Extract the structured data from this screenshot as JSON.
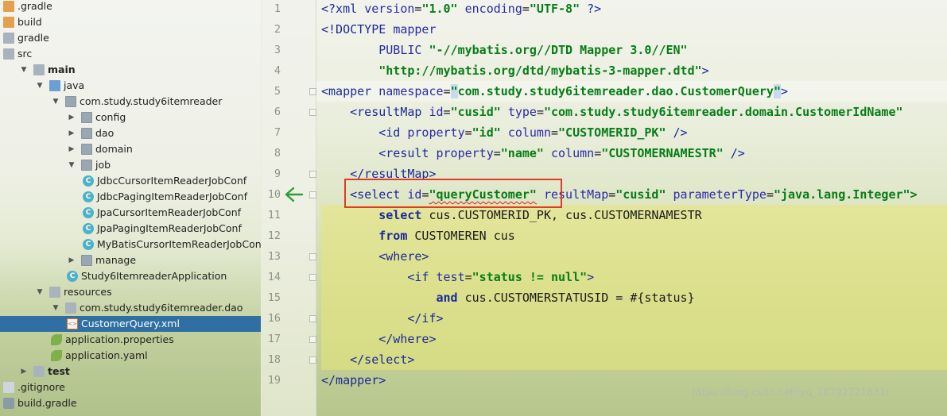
{
  "project_tree": {
    "items": [
      {
        "label": ".gradle",
        "indent": 0,
        "icon": "folder-orange-icon",
        "arrow": "",
        "bold": false
      },
      {
        "label": "build",
        "indent": 0,
        "icon": "folder-orange-icon",
        "arrow": "",
        "bold": false
      },
      {
        "label": "gradle",
        "indent": 0,
        "icon": "folder-icon",
        "arrow": "",
        "bold": false
      },
      {
        "label": "src",
        "indent": 0,
        "icon": "folder-icon",
        "arrow": "",
        "bold": false
      },
      {
        "label": "main",
        "indent": 1,
        "icon": "folder-icon",
        "arrow": "expanded",
        "bold": true
      },
      {
        "label": "java",
        "indent": 2,
        "icon": "folder-blue-icon",
        "arrow": "expanded",
        "bold": false
      },
      {
        "label": "com.study.study6itemreader",
        "indent": 3,
        "icon": "package-icon",
        "arrow": "expanded",
        "bold": false
      },
      {
        "label": "config",
        "indent": 4,
        "icon": "package-icon",
        "arrow": "collapsed",
        "bold": false
      },
      {
        "label": "dao",
        "indent": 4,
        "icon": "package-icon",
        "arrow": "collapsed",
        "bold": false
      },
      {
        "label": "domain",
        "indent": 4,
        "icon": "package-icon",
        "arrow": "collapsed",
        "bold": false
      },
      {
        "label": "job",
        "indent": 4,
        "icon": "package-icon",
        "arrow": "expanded",
        "bold": false
      },
      {
        "label": "JdbcCursorItemReaderJobConf",
        "indent": 5,
        "icon": "class-icon",
        "arrow": "",
        "bold": false
      },
      {
        "label": "JdbcPagingItemReaderJobConf",
        "indent": 5,
        "icon": "class-icon",
        "arrow": "",
        "bold": false
      },
      {
        "label": "JpaCursorItemReaderJobConf",
        "indent": 5,
        "icon": "class-icon",
        "arrow": "",
        "bold": false
      },
      {
        "label": "JpaPagingItemReaderJobConf",
        "indent": 5,
        "icon": "class-icon",
        "arrow": "",
        "bold": false
      },
      {
        "label": "MyBatisCursorItemReaderJobConf",
        "indent": 5,
        "icon": "class-icon",
        "arrow": "",
        "bold": false
      },
      {
        "label": "manage",
        "indent": 4,
        "icon": "package-icon",
        "arrow": "collapsed",
        "bold": false
      },
      {
        "label": "Study6ItemreaderApplication",
        "indent": 4,
        "icon": "spring-class-icon",
        "arrow": "",
        "bold": false
      },
      {
        "label": "resources",
        "indent": 2,
        "icon": "resources-folder-icon",
        "arrow": "expanded",
        "bold": false
      },
      {
        "label": "com.study.study6itemreader.dao",
        "indent": 3,
        "icon": "folder-icon",
        "arrow": "expanded",
        "bold": false
      },
      {
        "label": "CustomerQuery.xml",
        "indent": 4,
        "icon": "xml-file-icon",
        "arrow": "",
        "bold": false,
        "selected": true
      },
      {
        "label": "application.properties",
        "indent": 3,
        "icon": "spring-leaf-icon",
        "arrow": "",
        "bold": false
      },
      {
        "label": "application.yaml",
        "indent": 3,
        "icon": "spring-leaf-icon",
        "arrow": "",
        "bold": false
      },
      {
        "label": "test",
        "indent": 1,
        "icon": "folder-icon",
        "arrow": "collapsed",
        "bold": true
      },
      {
        "label": ".gitignore",
        "indent": 0,
        "icon": "file-icon",
        "arrow": "",
        "bold": false
      },
      {
        "label": "build.gradle",
        "indent": 0,
        "icon": "gradle-icon",
        "arrow": "",
        "bold": false
      }
    ]
  },
  "editor": {
    "line_numbers": [
      "1",
      "2",
      "3",
      "4",
      "5",
      "6",
      "7",
      "8",
      "9",
      "10",
      "11",
      "12",
      "13",
      "14",
      "15",
      "16",
      "17",
      "18",
      "19"
    ],
    "lines": [
      [
        [
          "t",
          "<?xml "
        ],
        [
          "a",
          "version"
        ],
        [
          "p",
          "="
        ],
        [
          "v",
          "\"1.0\""
        ],
        [
          "p",
          " "
        ],
        [
          "a",
          "encoding"
        ],
        [
          "p",
          "="
        ],
        [
          "v",
          "\"UTF-8\""
        ],
        [
          "p",
          " "
        ],
        [
          "t",
          "?>"
        ]
      ],
      [
        [
          "t",
          "<!DOCTYPE "
        ],
        [
          "a",
          "mapper"
        ]
      ],
      [
        [
          "p",
          "        "
        ],
        [
          "a",
          "PUBLIC "
        ],
        [
          "v",
          "\"-//mybatis.org//DTD Mapper 3.0//EN\""
        ]
      ],
      [
        [
          "p",
          "        "
        ],
        [
          "v",
          "\"http://mybatis.org/dtd/mybatis-3-mapper.dtd\""
        ],
        [
          "t",
          ">"
        ]
      ],
      [
        [
          "t",
          "<mapper "
        ],
        [
          "a",
          "namespace"
        ],
        [
          "p",
          "="
        ],
        [
          "vh",
          "\""
        ],
        [
          "v",
          "com.study.study6itemreader.dao.CustomerQuery"
        ],
        [
          "vh",
          "\""
        ],
        [
          "t",
          ">"
        ]
      ],
      [
        [
          "p",
          "    "
        ],
        [
          "t",
          "<resultMap "
        ],
        [
          "a",
          "id"
        ],
        [
          "p",
          "="
        ],
        [
          "v",
          "\"cusid\""
        ],
        [
          "p",
          " "
        ],
        [
          "a",
          "type"
        ],
        [
          "p",
          "="
        ],
        [
          "v",
          "\"com.study.study6itemreader.domain.CustomerIdName\""
        ]
      ],
      [
        [
          "p",
          "        "
        ],
        [
          "t",
          "<id "
        ],
        [
          "a",
          "property"
        ],
        [
          "p",
          "="
        ],
        [
          "v",
          "\"id\""
        ],
        [
          "p",
          " "
        ],
        [
          "a",
          "column"
        ],
        [
          "p",
          "="
        ],
        [
          "v",
          "\"CUSTOMERID_PK\""
        ],
        [
          "p",
          " "
        ],
        [
          "t",
          "/>"
        ]
      ],
      [
        [
          "p",
          "        "
        ],
        [
          "t",
          "<result "
        ],
        [
          "a",
          "property"
        ],
        [
          "p",
          "="
        ],
        [
          "v",
          "\"name\""
        ],
        [
          "p",
          " "
        ],
        [
          "a",
          "column"
        ],
        [
          "p",
          "="
        ],
        [
          "v",
          "\"CUSTOMERNAMESTR\""
        ],
        [
          "p",
          " "
        ],
        [
          "t",
          "/>"
        ]
      ],
      [
        [
          "p",
          "    "
        ],
        [
          "t",
          "</resultMap>"
        ]
      ],
      [
        [
          "p",
          "    "
        ],
        [
          "t",
          "<select "
        ],
        [
          "a",
          "id"
        ],
        [
          "p",
          "="
        ],
        [
          "vs",
          "\"queryCustomer\""
        ],
        [
          "p",
          " "
        ],
        [
          "a",
          "resultMap"
        ],
        [
          "p",
          "="
        ],
        [
          "v",
          "\"cusid\""
        ],
        [
          "p",
          " "
        ],
        [
          "a",
          "parameterType"
        ],
        [
          "p",
          "="
        ],
        [
          "v",
          "\"java.lang.Integer\">"
        ]
      ],
      [
        [
          "p",
          "        "
        ],
        [
          "k",
          "select "
        ],
        [
          "p",
          "cus.CUSTOMERID_PK, cus.CUSTOMERNAMESTR"
        ]
      ],
      [
        [
          "p",
          "        "
        ],
        [
          "k",
          "from "
        ],
        [
          "p",
          "CUSTOMEREN cus"
        ]
      ],
      [
        [
          "p",
          "        "
        ],
        [
          "t",
          "<where>"
        ]
      ],
      [
        [
          "p",
          "            "
        ],
        [
          "t",
          "<if "
        ],
        [
          "a",
          "test"
        ],
        [
          "p",
          "="
        ],
        [
          "v",
          "\"status != null\""
        ],
        [
          "t",
          ">"
        ]
      ],
      [
        [
          "p",
          "                "
        ],
        [
          "k",
          "and "
        ],
        [
          "p",
          "cus.CUSTOMERSTATUSID = #{status}"
        ]
      ],
      [
        [
          "p",
          "            "
        ],
        [
          "t",
          "</if>"
        ]
      ],
      [
        [
          "p",
          "        "
        ],
        [
          "t",
          "</where>"
        ]
      ],
      [
        [
          "p",
          "    "
        ],
        [
          "t",
          "</select>"
        ]
      ],
      [
        [
          "t",
          "</mapper>"
        ]
      ]
    ]
  },
  "gutter": {
    "marker": "green-back-arrow-icon",
    "marker_color": "#2e9e3a"
  },
  "annotation": {
    "color": "#e03a2a"
  },
  "watermark": "https://blog.csdn.net/jyq_18792721831/"
}
